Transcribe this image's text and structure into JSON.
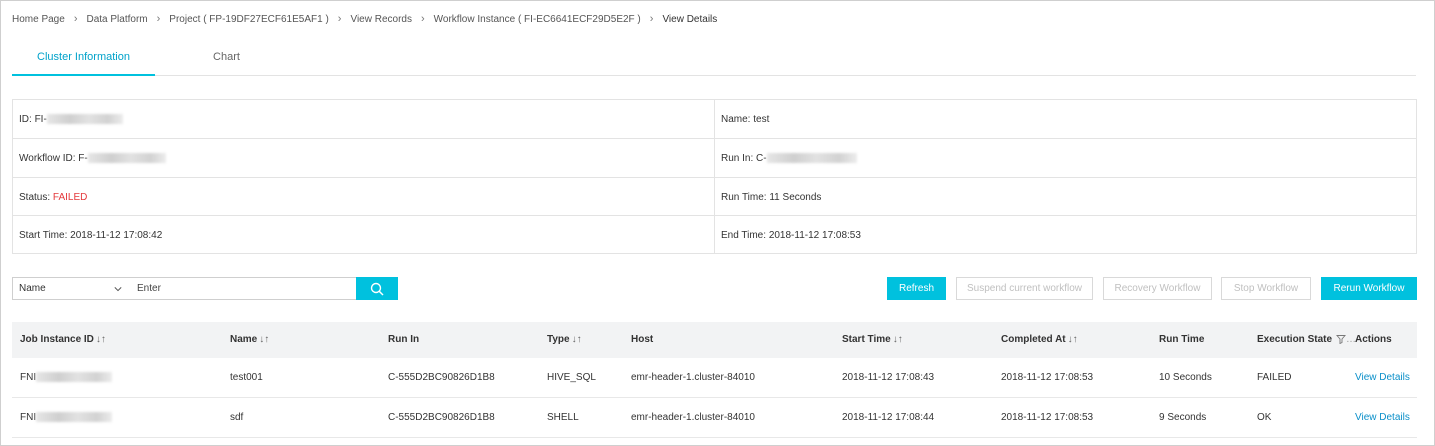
{
  "breadcrumb": [
    "Home Page",
    "Data Platform",
    "Project ( FP-19DF27ECF61E5AF1 )",
    "View Records",
    "Workflow Instance ( FI-EC6641ECF29D5E2F )",
    "View Details"
  ],
  "tabs": [
    "Cluster Information",
    "Chart"
  ],
  "info": {
    "id_label": "ID:",
    "id_value": "FI-",
    "name_label": "Name:",
    "name_value": "test",
    "workflow_id_label": "Workflow ID:",
    "workflow_id_value": "F-",
    "run_in_label": "Run In:",
    "run_in_value": "C-",
    "status_label": "Status:",
    "status_value": "FAILED",
    "run_time_label": "Run Time:",
    "run_time_value": "11 Seconds",
    "start_time_label": "Start Time:",
    "start_time_value": "2018-11-12 17:08:42",
    "end_time_label": "End Time:",
    "end_time_value": "2018-11-12 17:08:53"
  },
  "filter": {
    "field": "Name",
    "placeholder": "Enter",
    "search_icon": "search-icon",
    "chevron_icon": "chevron-down-icon"
  },
  "toolbar": {
    "refresh": "Refresh",
    "suspend": "Suspend current workflow",
    "recovery": "Recovery Workflow",
    "stop": "Stop Workflow",
    "rerun": "Rerun Workflow"
  },
  "table": {
    "headers": {
      "job_instance_id": "Job Instance ID",
      "name": "Name",
      "run_in": "Run In",
      "type": "Type",
      "host": "Host",
      "start_time": "Start Time",
      "completed_at": "Completed At",
      "run_time": "Run Time",
      "execution_state": "Execution State",
      "actions": "Actions"
    },
    "rows": [
      {
        "job_instance_id": "FNI",
        "name": "test001",
        "run_in": "C-555D2BC90826D1B8",
        "type": "HIVE_SQL",
        "host": "emr-header-1.cluster-84010",
        "start_time": "2018-11-12 17:08:43",
        "completed_at": "2018-11-12 17:08:53",
        "run_time": "10 Seconds",
        "execution_state": "FAILED",
        "action": "View Details"
      },
      {
        "job_instance_id": "FNI",
        "name": "sdf",
        "run_in": "C-555D2BC90826D1B8",
        "type": "SHELL",
        "host": "emr-header-1.cluster-84010",
        "start_time": "2018-11-12 17:08:44",
        "completed_at": "2018-11-12 17:08:53",
        "run_time": "9 Seconds",
        "execution_state": "OK",
        "action": "View Details"
      }
    ]
  },
  "colors": {
    "accent": "#00c1de",
    "failed": "#e4393c",
    "ok": "#1a8a24",
    "link": "#0a8fc9"
  }
}
